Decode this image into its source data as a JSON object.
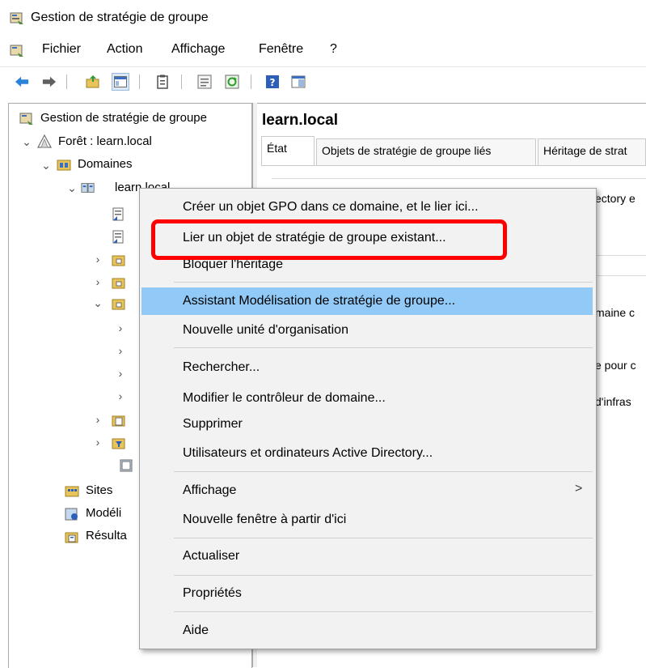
{
  "window": {
    "title": "Gestion de stratégie de groupe"
  },
  "menubar": {
    "items": [
      "Fichier",
      "Action",
      "Affichage",
      "Fenêtre",
      "?"
    ]
  },
  "tree": {
    "root": "Gestion de stratégie de groupe",
    "forest": "Forêt : learn.local",
    "domains": "Domaines",
    "domain": "learn.local",
    "sites": "Sites",
    "modeling": "Modéli",
    "results": "Résulta"
  },
  "right": {
    "title": "learn.local",
    "tabs": [
      "État",
      "Objets de stratégie de groupe liés",
      "Héritage de strat"
    ],
    "snippets": [
      "ectory e",
      "maine c",
      "e pour c",
      "d'infras"
    ]
  },
  "context_menu": {
    "items": [
      "Créer un objet GPO dans ce domaine, et le lier ici...",
      "Lier un objet de stratégie de groupe existant...",
      "Bloquer l'héritage",
      "Assistant Modélisation de stratégie de groupe...",
      "Nouvelle unité d'organisation",
      "Rechercher...",
      "Modifier le contrôleur de domaine...",
      "Supprimer",
      "Utilisateurs et ordinateurs Active Directory...",
      "Affichage",
      "Nouvelle fenêtre à partir d'ici",
      "Actualiser",
      "Propriétés",
      "Aide"
    ],
    "highlighted": "Assistant Modélisation de stratégie de groupe...",
    "submenu_arrow": ">"
  },
  "annotation": {
    "color": "#ff0000"
  },
  "colors": {
    "menu_highlight": "#91c9f7",
    "menu_bg": "#f2f2f2"
  }
}
